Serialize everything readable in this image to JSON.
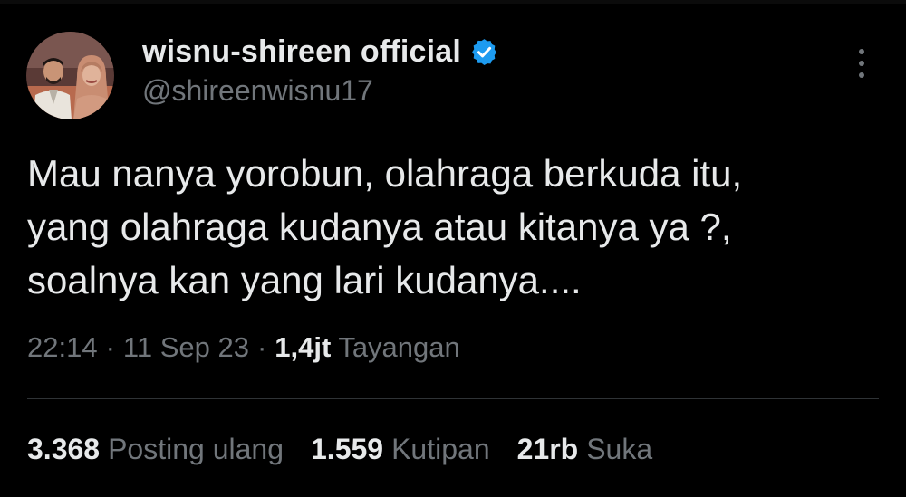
{
  "author": {
    "display_name": "wisnu-shireen official",
    "handle": "@shireenwisnu17",
    "verified": true,
    "verified_color": "#1d9bf0",
    "avatar_icon": "profile-photo-couple"
  },
  "more_icon": "vertical-ellipsis-icon",
  "tweet": {
    "lines": [
      "Mau nanya yorobun, olahraga berkuda itu,",
      "yang olahraga kudanya atau kitanya ya ?,",
      "soalnya kan yang lari kudanya...."
    ]
  },
  "meta": {
    "time": "22:14",
    "date": "11 Sep 23",
    "separator": "·",
    "views_count": "1,4jt",
    "views_label": "Tayangan"
  },
  "stats": {
    "reposts_count": "3.368",
    "reposts_label": "Posting ulang",
    "quotes_count": "1.559",
    "quotes_label": "Kutipan",
    "likes_count": "21rb",
    "likes_label": "Suka"
  },
  "colors": {
    "background": "#000000",
    "primary_text": "#e7e9ea",
    "secondary_text": "#71767b",
    "divider": "#2f3336"
  }
}
